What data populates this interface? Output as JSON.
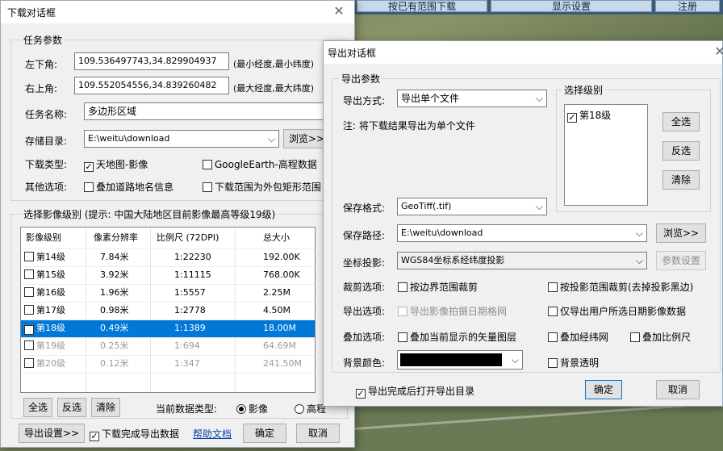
{
  "top_toolbar": {
    "btn_range_download": "按已有范围下载",
    "btn_display_settings": "显示设置",
    "btn_register": "注册"
  },
  "download_dialog": {
    "title": "下载对话框",
    "task_params": {
      "title": "任务参数",
      "lower_left_label": "左下角:",
      "lower_left_value": "109.536497743,34.829904937",
      "lower_left_hint": "(最小经度,最小纬度)",
      "upper_right_label": "右上角:",
      "upper_right_value": "109.552054556,34.839260482",
      "upper_right_hint": "(最大经度,最大纬度)",
      "task_name_label": "任务名称:",
      "task_name_value": "多边形区域",
      "storage_dir_label": "存储目录:",
      "storage_dir_value": "E:\\weitu\\download",
      "browse_label": "浏览>>",
      "download_type_label": "下载类型:",
      "type_tianditu": "天地图-影像",
      "type_google": "GoogleEarth-高程数据",
      "other_options_label": "其他选项:",
      "opt_road_names": "叠加道路地名信息",
      "opt_bbox": "下载范围为外包矩形范围"
    },
    "levels": {
      "title": "选择影像级别 (提示: 中国大陆地区目前影像最高等级19级)",
      "headers": [
        "影像级别",
        "像素分辨率",
        "比例尺 (72DPI)",
        "总大小"
      ],
      "rows": [
        {
          "level": "第14级",
          "res": "7.84米",
          "scale": "1:22230",
          "size": "192.00K",
          "checked": false
        },
        {
          "level": "第15级",
          "res": "3.92米",
          "scale": "1:11115",
          "size": "768.00K",
          "checked": false
        },
        {
          "level": "第16级",
          "res": "1.96米",
          "scale": "1:5557",
          "size": "2.25M",
          "checked": false
        },
        {
          "level": "第17级",
          "res": "0.98米",
          "scale": "1:2778",
          "size": "4.50M",
          "checked": false
        },
        {
          "level": "第18级",
          "res": "0.49米",
          "scale": "1:1389",
          "size": "18.00M",
          "checked": true
        },
        {
          "level": "第19级",
          "res": "0.25米",
          "scale": "1:694",
          "size": "64.69M",
          "checked": false
        },
        {
          "level": "第20级",
          "res": "0.12米",
          "scale": "1:347",
          "size": "241.50M",
          "checked": false
        }
      ],
      "select_all": "全选",
      "invert": "反选",
      "clear": "清除",
      "data_type_label": "当前数据类型:",
      "radio_image": "影像",
      "radio_elevation": "高程"
    },
    "footer": {
      "export_settings": "导出设置>>",
      "export_on_finish": "下载完成导出数据",
      "help": "帮助文档",
      "ok": "确定",
      "cancel": "取消"
    }
  },
  "export_dialog": {
    "title": "导出对话框",
    "params_title": "导出参数",
    "export_mode_label": "导出方式:",
    "export_mode_value": "导出单个文件",
    "note": "注: 将下载结果导出为单个文件",
    "level_group_title": "选择级别",
    "level_item": "第18级",
    "select_all": "全选",
    "invert": "反选",
    "clear": "清除",
    "save_format_label": "保存格式:",
    "save_format_value": "GeoTiff(.tif)",
    "save_path_label": "保存路径:",
    "save_path_value": "E:\\weitu\\download",
    "browse_label": "浏览>>",
    "projection_label": "坐标投影:",
    "projection_value": "WGS84坐标系经纬度投影",
    "projection_settings": "参数设置",
    "clip_label": "裁剪选项:",
    "clip_by_boundary": "按边界范围裁剪",
    "clip_by_projection": "按投影范围裁剪(去掉投影黑边)",
    "export_options_label": "导出选项:",
    "export_capture_date": "导出影像拍摄日期格网",
    "export_user_dates": "仅导出用户所选日期影像数据",
    "overlay_label": "叠加选项:",
    "overlay_vectors": "叠加当前显示的矢量图层",
    "overlay_graticule": "叠加经纬网",
    "overlay_scale": "叠加比例尺",
    "bg_color_label": "背景颜色:",
    "bg_color": "#000000",
    "bg_transparent": "背景透明",
    "open_dir_on_finish": "导出完成后打开导出目录",
    "ok": "确定",
    "cancel": "取消"
  },
  "colors": {
    "selection": "#0078d7",
    "dialog_bg": "#f0f0f0",
    "link": "#0645ad"
  }
}
